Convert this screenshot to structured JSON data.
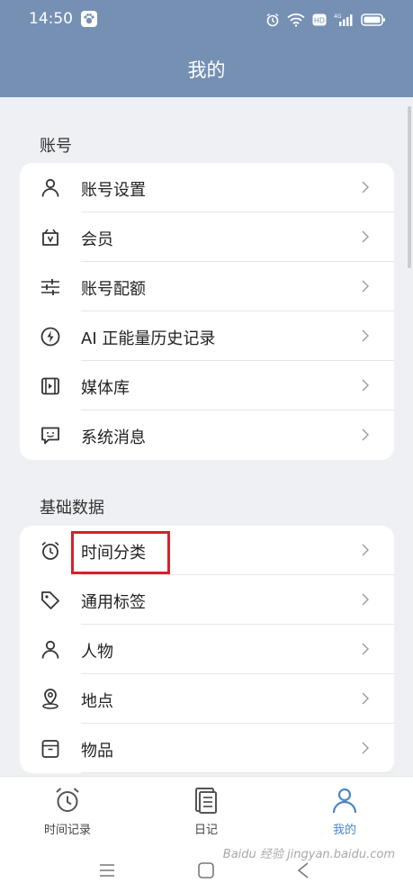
{
  "status": {
    "time": "14:50"
  },
  "header": {
    "title": "我的"
  },
  "sections": [
    {
      "title": "账号",
      "items": [
        {
          "label": "账号设置",
          "icon": "person-icon"
        },
        {
          "label": "会员",
          "icon": "vip-icon"
        },
        {
          "label": "账号配额",
          "icon": "sliders-icon"
        },
        {
          "label": "AI 正能量历史记录",
          "icon": "lightning-icon"
        },
        {
          "label": "媒体库",
          "icon": "media-icon"
        },
        {
          "label": "系统消息",
          "icon": "message-icon"
        }
      ]
    },
    {
      "title": "基础数据",
      "items": [
        {
          "label": "时间分类",
          "icon": "alarm-icon"
        },
        {
          "label": "通用标签",
          "icon": "tag-icon"
        },
        {
          "label": "人物",
          "icon": "person-icon"
        },
        {
          "label": "地点",
          "icon": "location-icon"
        },
        {
          "label": "物品",
          "icon": "box-icon"
        }
      ]
    }
  ],
  "tabs": [
    {
      "label": "时间记录",
      "icon": "alarm-icon",
      "active": false
    },
    {
      "label": "日记",
      "icon": "diary-icon",
      "active": false
    },
    {
      "label": "我的",
      "icon": "person-icon",
      "active": true
    }
  ],
  "watermark": "Baidu 经验 jingyan.baidu.com",
  "colors": {
    "header": "#7590b3",
    "accent": "#4a86c8",
    "highlight": "#d9202c"
  }
}
